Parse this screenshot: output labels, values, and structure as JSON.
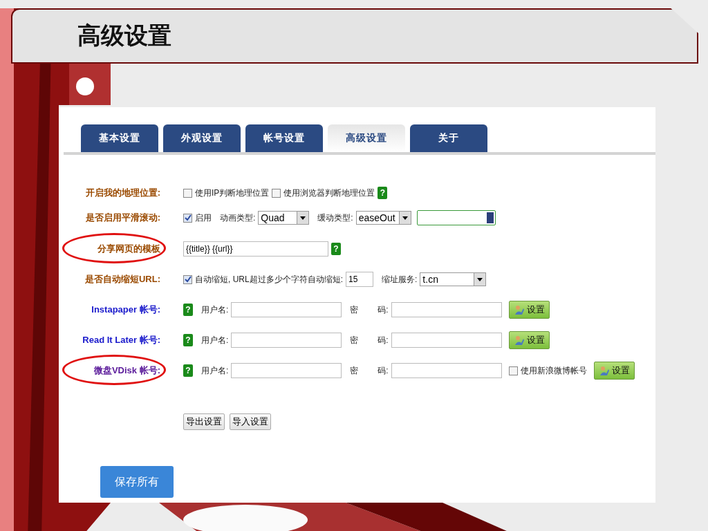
{
  "slide": {
    "title": "高级设置"
  },
  "tabs": [
    {
      "label": "基本设置",
      "selected": false
    },
    {
      "label": "外观设置",
      "selected": false
    },
    {
      "label": "帐号设置",
      "selected": false
    },
    {
      "label": "高级设置",
      "selected": true
    },
    {
      "label": "关于",
      "selected": false
    }
  ],
  "rows": [
    {
      "kind": "checkboxes",
      "label": "开启我的地理位置:",
      "color": "#9a4a00",
      "circled": false,
      "options": [
        {
          "label": "使用IP判断地理位置",
          "checked": false
        },
        {
          "label": "使用浏览器判断地理位置",
          "checked": false
        }
      ],
      "help": "?"
    },
    {
      "kind": "scroll",
      "label": "是否启用平滑滚动:",
      "color": "#9a4a00",
      "circled": false,
      "enable": {
        "label": "启用",
        "checked": true
      },
      "selects": [
        {
          "label": "动画类型:",
          "value": "Quad"
        },
        {
          "label": "缓动类型:",
          "value": "easeOut"
        }
      ]
    },
    {
      "kind": "template",
      "label": "分享网页的模板",
      "color": "#9a4a00",
      "circled": true,
      "value": "{{title}} {{url}}",
      "help": "?"
    },
    {
      "kind": "shorten",
      "label": "是否自动缩短URL:",
      "color": "#9a4a00",
      "circled": false,
      "enable": {
        "label": "自动缩短, URL超过多少个字符自动缩短:",
        "checked": true
      },
      "number": "15",
      "select": {
        "label": "缩址服务:",
        "value": "t.cn"
      }
    },
    {
      "kind": "account",
      "label": "Instapaper 帐号:",
      "color": "#1a1acc",
      "circled": false,
      "help": "?",
      "user_label": "用户名:",
      "pass_label": [
        "密",
        "码:"
      ],
      "button": "设置"
    },
    {
      "kind": "account",
      "label": "Read It Later 帐号:",
      "color": "#1a1acc",
      "circled": false,
      "help": "?",
      "user_label": "用户名:",
      "pass_label": [
        "密",
        "码:"
      ],
      "button": "设置"
    },
    {
      "kind": "account",
      "label": "微盘VDisk 帐号:",
      "color": "#5a1a9a",
      "circled": true,
      "help": "?",
      "user_label": "用户名:",
      "pass_label": [
        "密",
        "码:"
      ],
      "extra": {
        "label": "使用新浪微博帐号",
        "checked": false
      },
      "button": "设置"
    }
  ],
  "actions": [
    "导出设置",
    "导入设置"
  ],
  "save": "保存所有"
}
